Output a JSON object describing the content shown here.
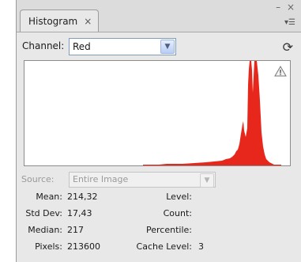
{
  "tab": {
    "title": "Histogram",
    "close": "×"
  },
  "window_controls": "– ×",
  "panel_menu_glyph": "▾☰",
  "channel": {
    "label": "Channel:",
    "value": "Red"
  },
  "source": {
    "label": "Source:",
    "value": "Entire Image"
  },
  "stats": {
    "mean_label": "Mean:",
    "mean": "214,32",
    "stddev_label": "Std Dev:",
    "stddev": "17,43",
    "median_label": "Median:",
    "median": "217",
    "pixels_label": "Pixels:",
    "pixels": "213600",
    "level_label": "Level:",
    "level": "",
    "count_label": "Count:",
    "count": "",
    "percentile_label": "Percentile:",
    "percentile": "",
    "cache_label": "Cache Level:",
    "cache": "3"
  },
  "colors": {
    "histogram": "#e8271c",
    "panel_bg": "#e8e8e8"
  },
  "icons": {
    "refresh": "refresh-icon",
    "warning": "warning-icon",
    "dropdown": "chevron-down-icon"
  }
}
